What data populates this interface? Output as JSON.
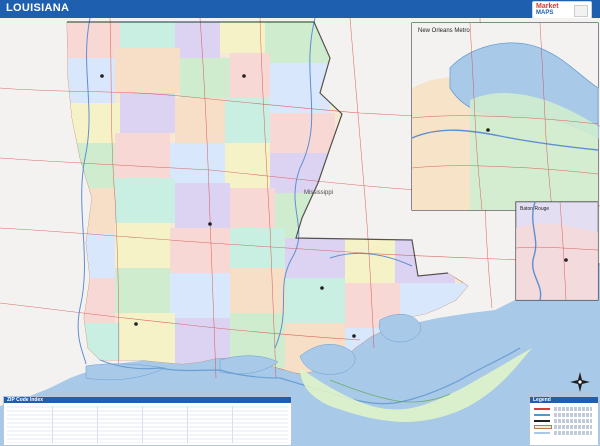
{
  "header": {
    "title": "LOUISIANA",
    "logo_line1": "Market",
    "logo_line2": "MAPS"
  },
  "map": {
    "state_label": "Mississippi",
    "inset_top_right": "New Orleans Metro",
    "inset_right": "Baton Rouge"
  },
  "legend_table": {
    "title": "ZIP Code Index"
  },
  "legend_box": {
    "title": "Legend"
  },
  "colors": {
    "header": "#1f5fb0",
    "water": "#a9c9e8",
    "land": "#f3f0e8",
    "mississippi_land": "#f3f2f0"
  }
}
